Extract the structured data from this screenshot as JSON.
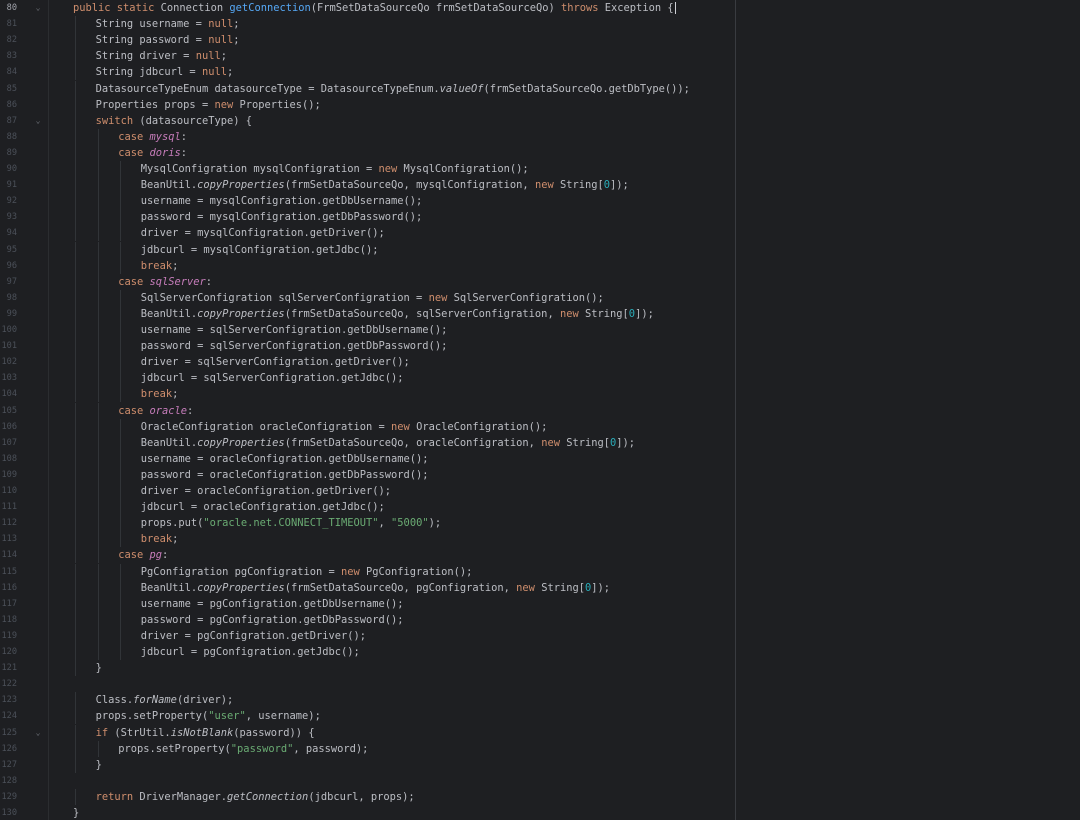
{
  "colors": {
    "background": "#1e1f22",
    "keyword": "#cf8e6d",
    "method_declaration": "#56a8f5",
    "enum_constant": "#c77dbb",
    "string": "#6aab73",
    "number": "#2aacb8",
    "plain": "#bcbec4",
    "line_number": "#4b5059"
  },
  "editor": {
    "active_line": "80",
    "lines": [
      {
        "n": "80",
        "fold": "⌄",
        "indent": 0,
        "tokens": [
          [
            "kw",
            "public static "
          ],
          [
            "",
            "Connection "
          ],
          [
            "fn",
            "getConnection"
          ],
          [
            "",
            "(FrmSetDataSourceQo frmSetDataSourceQo) "
          ],
          [
            "kw",
            "throws "
          ],
          [
            "",
            "Exception {"
          ]
        ],
        "caret": true
      },
      {
        "n": "81",
        "indent": 1,
        "tokens": [
          [
            "",
            "String username = "
          ],
          [
            "kw",
            "null"
          ],
          [
            "",
            ";"
          ]
        ]
      },
      {
        "n": "82",
        "indent": 1,
        "tokens": [
          [
            "",
            "String password = "
          ],
          [
            "kw",
            "null"
          ],
          [
            "",
            ";"
          ]
        ]
      },
      {
        "n": "83",
        "indent": 1,
        "tokens": [
          [
            "",
            "String driver = "
          ],
          [
            "kw",
            "null"
          ],
          [
            "",
            ";"
          ]
        ]
      },
      {
        "n": "84",
        "indent": 1,
        "tokens": [
          [
            "",
            "String jdbcurl = "
          ],
          [
            "kw",
            "null"
          ],
          [
            "",
            ";"
          ]
        ]
      },
      {
        "n": "85",
        "indent": 1,
        "tokens": [
          [
            "",
            "DatasourceTypeEnum datasourceType = DatasourceTypeEnum."
          ],
          [
            "it",
            "valueOf"
          ],
          [
            "",
            "(frmSetDataSourceQo.getDbType());"
          ]
        ]
      },
      {
        "n": "86",
        "indent": 1,
        "tokens": [
          [
            "",
            "Properties props = "
          ],
          [
            "kw",
            "new "
          ],
          [
            "",
            "Properties();"
          ]
        ]
      },
      {
        "n": "87",
        "fold": "⌄",
        "indent": 1,
        "tokens": [
          [
            "kw",
            "switch "
          ],
          [
            "",
            "(datasourceType) {"
          ]
        ]
      },
      {
        "n": "88",
        "indent": 2,
        "tokens": [
          [
            "kw",
            "case "
          ],
          [
            "cst",
            "mysql"
          ],
          [
            "",
            ":"
          ]
        ]
      },
      {
        "n": "89",
        "indent": 2,
        "tokens": [
          [
            "kw",
            "case "
          ],
          [
            "cst",
            "doris"
          ],
          [
            "",
            ":"
          ]
        ]
      },
      {
        "n": "90",
        "indent": 3,
        "tokens": [
          [
            "",
            "MysqlConfigration mysqlConfigration = "
          ],
          [
            "kw",
            "new "
          ],
          [
            "",
            "MysqlConfigration();"
          ]
        ]
      },
      {
        "n": "91",
        "indent": 3,
        "tokens": [
          [
            "",
            "BeanUtil."
          ],
          [
            "it",
            "copyProperties"
          ],
          [
            "",
            "(frmSetDataSourceQo, mysqlConfigration, "
          ],
          [
            "kw",
            "new "
          ],
          [
            "",
            "String["
          ],
          [
            "num",
            "0"
          ],
          [
            "",
            "]);"
          ]
        ]
      },
      {
        "n": "92",
        "indent": 3,
        "tokens": [
          [
            "",
            "username = mysqlConfigration.getDbUsername();"
          ]
        ]
      },
      {
        "n": "93",
        "indent": 3,
        "tokens": [
          [
            "",
            "password = mysqlConfigration.getDbPassword();"
          ]
        ]
      },
      {
        "n": "94",
        "indent": 3,
        "tokens": [
          [
            "",
            "driver = mysqlConfigration.getDriver();"
          ]
        ]
      },
      {
        "n": "95",
        "indent": 3,
        "tokens": [
          [
            "",
            "jdbcurl = mysqlConfigration.getJdbc();"
          ]
        ]
      },
      {
        "n": "96",
        "indent": 3,
        "tokens": [
          [
            "kw",
            "break"
          ],
          [
            "",
            ";"
          ]
        ]
      },
      {
        "n": "97",
        "indent": 2,
        "tokens": [
          [
            "kw",
            "case "
          ],
          [
            "cst",
            "sqlServer"
          ],
          [
            "",
            ":"
          ]
        ]
      },
      {
        "n": "98",
        "indent": 3,
        "tokens": [
          [
            "",
            "SqlServerConfigration sqlServerConfigration = "
          ],
          [
            "kw",
            "new "
          ],
          [
            "",
            "SqlServerConfigration();"
          ]
        ]
      },
      {
        "n": "99",
        "indent": 3,
        "tokens": [
          [
            "",
            "BeanUtil."
          ],
          [
            "it",
            "copyProperties"
          ],
          [
            "",
            "(frmSetDataSourceQo, sqlServerConfigration, "
          ],
          [
            "kw",
            "new "
          ],
          [
            "",
            "String["
          ],
          [
            "num",
            "0"
          ],
          [
            "",
            "]);"
          ]
        ]
      },
      {
        "n": "100",
        "indent": 3,
        "tokens": [
          [
            "",
            "username = sqlServerConfigration.getDbUsername();"
          ]
        ]
      },
      {
        "n": "101",
        "indent": 3,
        "tokens": [
          [
            "",
            "password = sqlServerConfigration.getDbPassword();"
          ]
        ]
      },
      {
        "n": "102",
        "indent": 3,
        "tokens": [
          [
            "",
            "driver = sqlServerConfigration.getDriver();"
          ]
        ]
      },
      {
        "n": "103",
        "indent": 3,
        "tokens": [
          [
            "",
            "jdbcurl = sqlServerConfigration.getJdbc();"
          ]
        ]
      },
      {
        "n": "104",
        "indent": 3,
        "tokens": [
          [
            "kw",
            "break"
          ],
          [
            "",
            ";"
          ]
        ]
      },
      {
        "n": "105",
        "indent": 2,
        "tokens": [
          [
            "kw",
            "case "
          ],
          [
            "cst",
            "oracle"
          ],
          [
            "",
            ":"
          ]
        ]
      },
      {
        "n": "106",
        "indent": 3,
        "tokens": [
          [
            "",
            "OracleConfigration oracleConfigration = "
          ],
          [
            "kw",
            "new "
          ],
          [
            "",
            "OracleConfigration();"
          ]
        ]
      },
      {
        "n": "107",
        "indent": 3,
        "tokens": [
          [
            "",
            "BeanUtil."
          ],
          [
            "it",
            "copyProperties"
          ],
          [
            "",
            "(frmSetDataSourceQo, oracleConfigration, "
          ],
          [
            "kw",
            "new "
          ],
          [
            "",
            "String["
          ],
          [
            "num",
            "0"
          ],
          [
            "",
            "]);"
          ]
        ]
      },
      {
        "n": "108",
        "indent": 3,
        "tokens": [
          [
            "",
            "username = oracleConfigration.getDbUsername();"
          ]
        ]
      },
      {
        "n": "109",
        "indent": 3,
        "tokens": [
          [
            "",
            "password = oracleConfigration.getDbPassword();"
          ]
        ]
      },
      {
        "n": "110",
        "indent": 3,
        "tokens": [
          [
            "",
            "driver = oracleConfigration.getDriver();"
          ]
        ]
      },
      {
        "n": "111",
        "indent": 3,
        "tokens": [
          [
            "",
            "jdbcurl = oracleConfigration.getJdbc();"
          ]
        ]
      },
      {
        "n": "112",
        "indent": 3,
        "tokens": [
          [
            "",
            "props.put("
          ],
          [
            "str",
            "\"oracle.net.CONNECT_TIMEOUT\""
          ],
          [
            "",
            ", "
          ],
          [
            "str",
            "\"5000\""
          ],
          [
            "",
            ");"
          ]
        ]
      },
      {
        "n": "113",
        "indent": 3,
        "tokens": [
          [
            "kw",
            "break"
          ],
          [
            "",
            ";"
          ]
        ]
      },
      {
        "n": "114",
        "indent": 2,
        "tokens": [
          [
            "kw",
            "case "
          ],
          [
            "cst",
            "pg"
          ],
          [
            "",
            ":"
          ]
        ]
      },
      {
        "n": "115",
        "indent": 3,
        "tokens": [
          [
            "",
            "PgConfigration pgConfigration = "
          ],
          [
            "kw",
            "new "
          ],
          [
            "",
            "PgConfigration();"
          ]
        ]
      },
      {
        "n": "116",
        "indent": 3,
        "tokens": [
          [
            "",
            "BeanUtil."
          ],
          [
            "it",
            "copyProperties"
          ],
          [
            "",
            "(frmSetDataSourceQo, pgConfigration, "
          ],
          [
            "kw",
            "new "
          ],
          [
            "",
            "String["
          ],
          [
            "num",
            "0"
          ],
          [
            "",
            "]);"
          ]
        ]
      },
      {
        "n": "117",
        "indent": 3,
        "tokens": [
          [
            "",
            "username = pgConfigration.getDbUsername();"
          ]
        ]
      },
      {
        "n": "118",
        "indent": 3,
        "tokens": [
          [
            "",
            "password = pgConfigration.getDbPassword();"
          ]
        ]
      },
      {
        "n": "119",
        "indent": 3,
        "tokens": [
          [
            "",
            "driver = pgConfigration.getDriver();"
          ]
        ]
      },
      {
        "n": "120",
        "indent": 3,
        "tokens": [
          [
            "",
            "jdbcurl = pgConfigration.getJdbc();"
          ]
        ]
      },
      {
        "n": "121",
        "indent": 1,
        "tokens": [
          [
            "",
            "}"
          ]
        ]
      },
      {
        "n": "122",
        "indent": 0,
        "tokens": []
      },
      {
        "n": "123",
        "indent": 1,
        "tokens": [
          [
            "",
            "Class."
          ],
          [
            "it",
            "forName"
          ],
          [
            "",
            "(driver);"
          ]
        ]
      },
      {
        "n": "124",
        "indent": 1,
        "tokens": [
          [
            "",
            "props.setProperty("
          ],
          [
            "str",
            "\"user\""
          ],
          [
            "",
            ", username);"
          ]
        ]
      },
      {
        "n": "125",
        "fold": "⌄",
        "indent": 1,
        "tokens": [
          [
            "kw",
            "if "
          ],
          [
            "",
            "(StrUtil."
          ],
          [
            "it",
            "isNotBlank"
          ],
          [
            "",
            "(password)) {"
          ]
        ]
      },
      {
        "n": "126",
        "indent": 2,
        "tokens": [
          [
            "",
            "props.setProperty("
          ],
          [
            "str",
            "\"password\""
          ],
          [
            "",
            ", password);"
          ]
        ]
      },
      {
        "n": "127",
        "indent": 1,
        "tokens": [
          [
            "",
            "}"
          ]
        ]
      },
      {
        "n": "128",
        "indent": 0,
        "tokens": []
      },
      {
        "n": "129",
        "indent": 1,
        "tokens": [
          [
            "kw",
            "return "
          ],
          [
            "",
            "DriverManager."
          ],
          [
            "it",
            "getConnection"
          ],
          [
            "",
            "(jdbcurl, props);"
          ]
        ]
      },
      {
        "n": "130",
        "indent": 0,
        "tokens": [
          [
            "",
            "}"
          ]
        ]
      }
    ]
  }
}
